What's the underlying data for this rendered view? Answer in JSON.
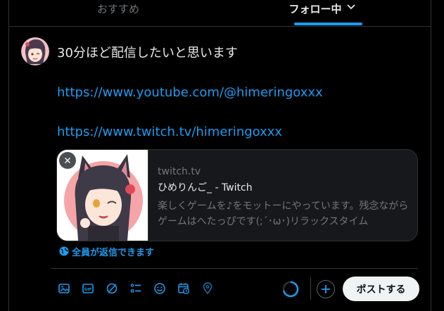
{
  "tabs": {
    "recommended": "おすすめ",
    "following": "フォロー中"
  },
  "compose": {
    "line1": "30分ほど配信したいと思います",
    "link1": "https://www.youtube.com/@himeringoxxx",
    "link2": "https://www.twitch.tv/himeringoxxx"
  },
  "card": {
    "domain": "twitch.tv",
    "title": "ひめりんご_ - Twitch",
    "description": "楽しくゲームを♪をモットーにやっています。残念ながらゲームはへたっぴです(;´･ω･)リラックスタイム"
  },
  "reply_setting": "全員が返信できます",
  "post_button": "ポストする",
  "colors": {
    "accent": "#1d9bf0",
    "background": "#000000",
    "border": "#2f3336",
    "muted_text": "#71767b"
  },
  "icons": [
    "image-icon",
    "gif-icon",
    "grok-icon",
    "poll-icon",
    "emoji-icon",
    "schedule-icon",
    "location-icon",
    "add-icon",
    "close-icon",
    "globe-icon",
    "chevron-down-icon"
  ]
}
